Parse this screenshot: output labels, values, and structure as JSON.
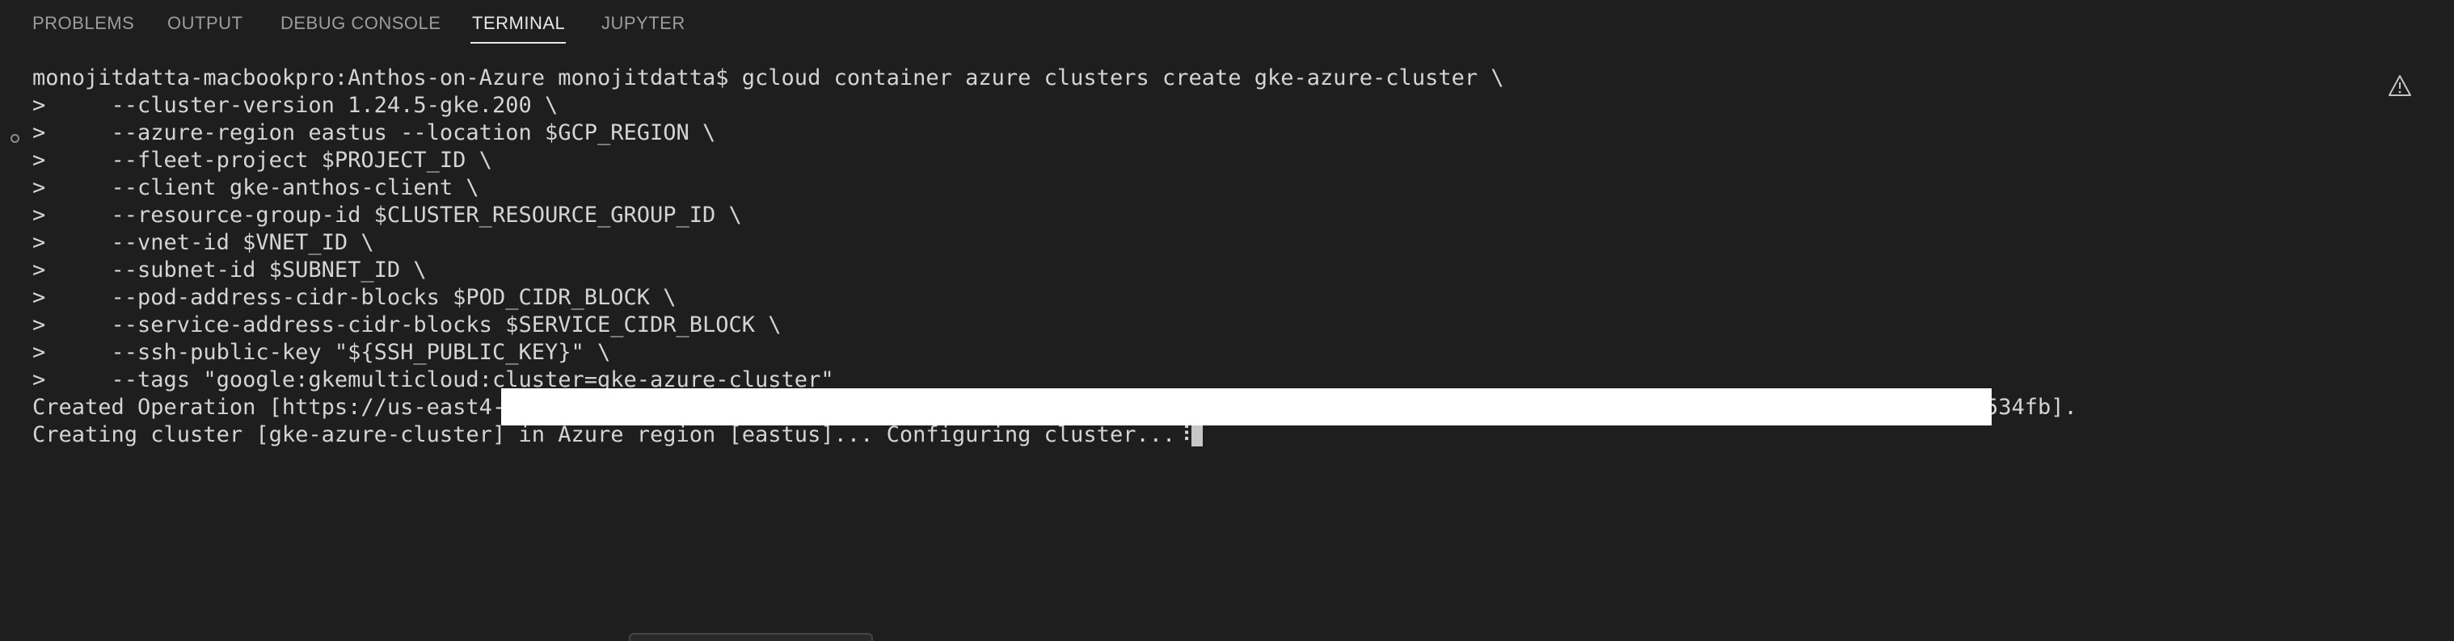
{
  "panel": {
    "tabs": [
      {
        "label": "PROBLEMS"
      },
      {
        "label": "OUTPUT"
      },
      {
        "label": "DEBUG CONSOLE"
      },
      {
        "label": "TERMINAL"
      },
      {
        "label": "JUPYTER"
      }
    ],
    "active_tab": "TERMINAL"
  },
  "terminal": {
    "lines": [
      "monojitdatta-macbookpro:Anthos-on-Azure monojitdatta$ gcloud container azure clusters create gke-azure-cluster \\",
      ">     --cluster-version 1.24.5-gke.200 \\",
      ">     --azure-region eastus --location $GCP_REGION \\",
      ">     --fleet-project $PROJECT_ID \\",
      ">     --client gke-anthos-client \\",
      ">     --resource-group-id $CLUSTER_RESOURCE_GROUP_ID \\",
      ">     --vnet-id $VNET_ID \\",
      ">     --subnet-id $SUBNET_ID \\",
      ">     --pod-address-cidr-blocks $POD_CIDR_BLOCK \\",
      ">     --service-address-cidr-blocks $SERVICE_CIDR_BLOCK \\",
      ">     --ssh-public-key \"${SSH_PUBLIC_KEY}\" \\",
      ">     --tags \"google:gkemulticloud:cluster=gke-azure-cluster\"",
      "Created Operation [https://us-east4-",
      "Creating cluster [gke-azure-cluster] in Azure region [eastus]... Configuring cluster...⠸"
    ],
    "operation_suffix": "534fb]."
  },
  "icons": {
    "prompt_indicator": "circle-outline-icon",
    "warning": "warning-triangle-icon",
    "cursor": "terminal-cursor-icon"
  },
  "colors": {
    "background": "#1e1e1e",
    "text": "#d4d4d4",
    "tab_inactive": "#9d9d9d",
    "tab_active": "#e7e7e7",
    "redaction": "#ffffff"
  }
}
